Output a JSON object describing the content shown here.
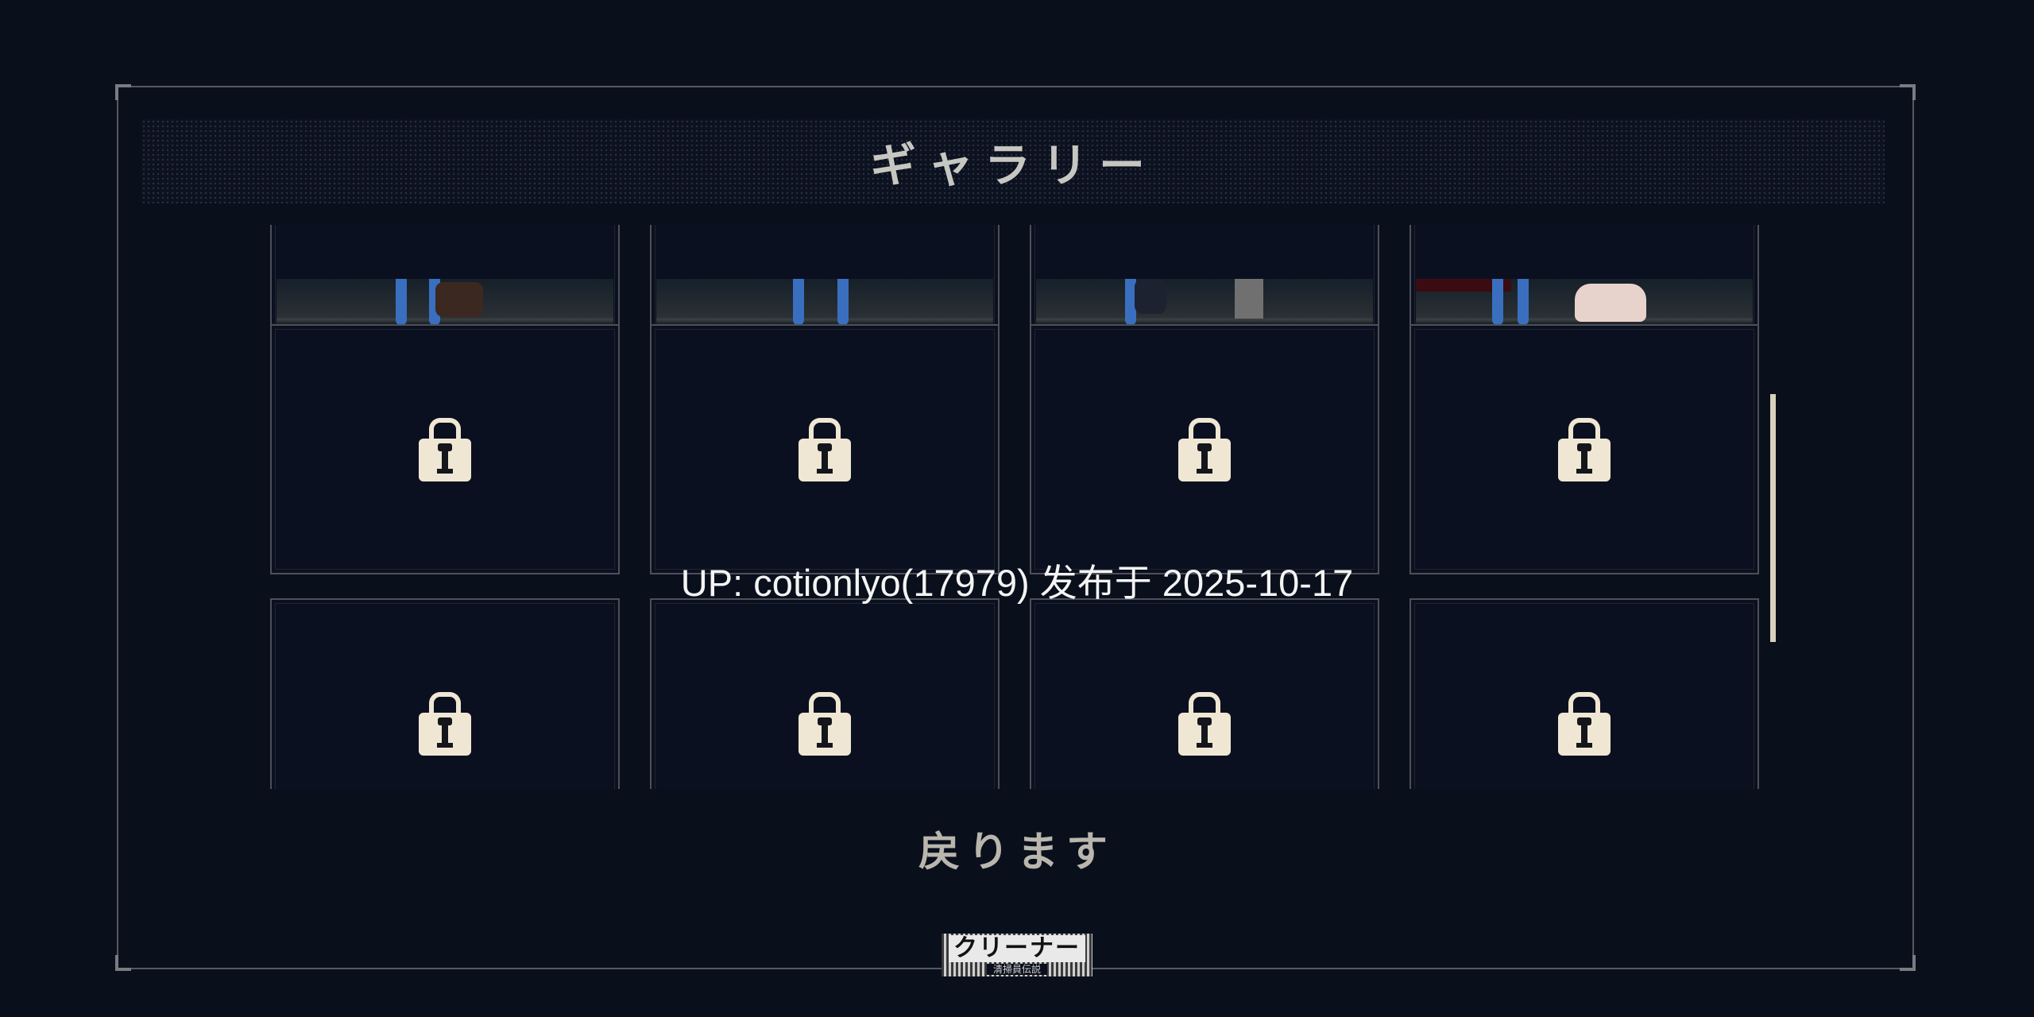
{
  "header": {
    "title": "ギャラリー"
  },
  "gallery": {
    "cells": [
      {
        "state": "unlocked",
        "icon": "scene-thumbnail"
      },
      {
        "state": "unlocked",
        "icon": "scene-thumbnail"
      },
      {
        "state": "unlocked",
        "icon": "scene-thumbnail"
      },
      {
        "state": "unlocked",
        "icon": "scene-thumbnail"
      },
      {
        "state": "locked",
        "icon": "lock-icon"
      },
      {
        "state": "locked",
        "icon": "lock-icon"
      },
      {
        "state": "locked",
        "icon": "lock-icon"
      },
      {
        "state": "locked",
        "icon": "lock-icon"
      },
      {
        "state": "locked",
        "icon": "lock-icon"
      },
      {
        "state": "locked",
        "icon": "lock-icon"
      },
      {
        "state": "locked",
        "icon": "lock-icon"
      },
      {
        "state": "locked",
        "icon": "lock-icon"
      }
    ]
  },
  "footer": {
    "back_label": "戻ります"
  },
  "overlay": {
    "caption": "UP: cotionlyo(17979) 发布于 2025-10-17"
  },
  "logo": {
    "main": "クリーナー",
    "sub": "清掃員伝説"
  },
  "colors": {
    "background": "#0a0f1c",
    "frame": "#55585e",
    "lock": "#efe7d3",
    "text": "#c7c7c2"
  }
}
